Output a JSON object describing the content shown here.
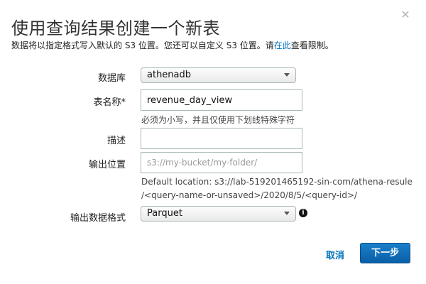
{
  "dialog": {
    "title": "使用查询结果创建一个新表",
    "subtitle_before_link": "数据将以指定格式写入默认的 S3 位置。您还可以自定义 S3 位置。请",
    "subtitle_link": "在此",
    "subtitle_after_link": "查看限制。"
  },
  "form": {
    "database_label": "数据库",
    "database_value": "athenadb",
    "table_name_label": "表名称*",
    "table_name_value": "revenue_day_view",
    "table_name_hint": "必须为小写，并且仅使用下划线特殊字符",
    "description_label": "描述",
    "description_value": "",
    "output_location_label": "输出位置",
    "output_location_placeholder": "s3://my-bucket/my-folder/",
    "default_location_line1": "Default location: s3://lab-519201465192-sin-com/athena-resule",
    "default_location_line2": "/<query-name-or-unsaved>/2020/8/5/<query-id>/",
    "output_format_label": "输出数据格式",
    "output_format_value": "Parquet"
  },
  "footer": {
    "cancel_label": "取消",
    "next_label": "下一步"
  },
  "icons": {
    "close": "close-icon",
    "info": "info-icon",
    "dropdown": "chevron-down-icon"
  },
  "colors": {
    "link": "#0073bb",
    "primary_button": "#0d6ab5",
    "border": "#aab7b8"
  }
}
